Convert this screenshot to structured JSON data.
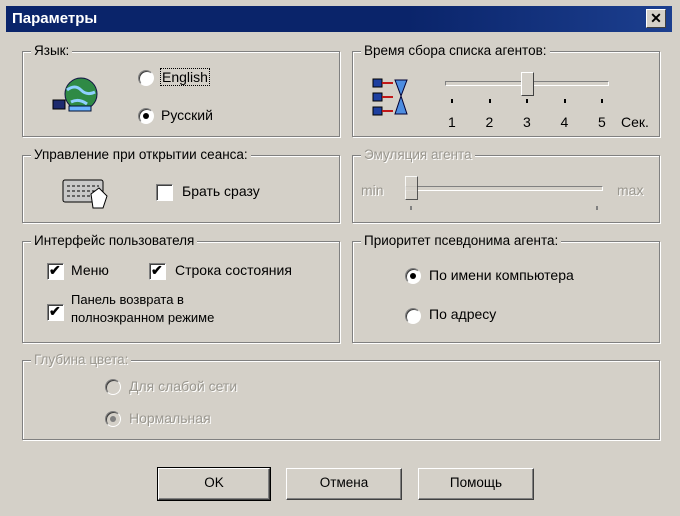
{
  "window": {
    "title": "Параметры",
    "close_glyph": "✕"
  },
  "language": {
    "legend": "Язык:",
    "options": [
      "English",
      "Русский"
    ],
    "selected": "Русский"
  },
  "agent_list_time": {
    "legend": "Время сбора списка агентов:",
    "ticks": [
      "1",
      "2",
      "3",
      "4",
      "5"
    ],
    "unit": "Сек.",
    "value": 3
  },
  "session": {
    "legend": "Управление при открытии сеанса:",
    "take_now_label": "Брать сразу",
    "take_now_checked": false
  },
  "agent_emulation": {
    "legend": "Эмуляция агента",
    "min_label": "min",
    "max_label": "max",
    "enabled": false,
    "value": 0
  },
  "ui": {
    "legend": "Интерфейс пользователя",
    "menu_label": "Меню",
    "menu_checked": true,
    "statusbar_label": "Строка состояния",
    "statusbar_checked": true,
    "return_panel_label_1": "Панель возврата в",
    "return_panel_label_2": "полноэкранном режиме",
    "return_panel_checked": true
  },
  "alias_priority": {
    "legend": "Приоритет псевдонима агента:",
    "options": [
      "По имени компьютера",
      "По адресу"
    ],
    "selected": "По имени компьютера"
  },
  "color_depth": {
    "legend": "Глубина цвета:",
    "options": [
      "Для слабой сети",
      "Нормальная"
    ],
    "selected": "Нормальная",
    "enabled": false
  },
  "buttons": {
    "ok": "OK",
    "cancel": "Отмена",
    "help": "Помощь"
  }
}
